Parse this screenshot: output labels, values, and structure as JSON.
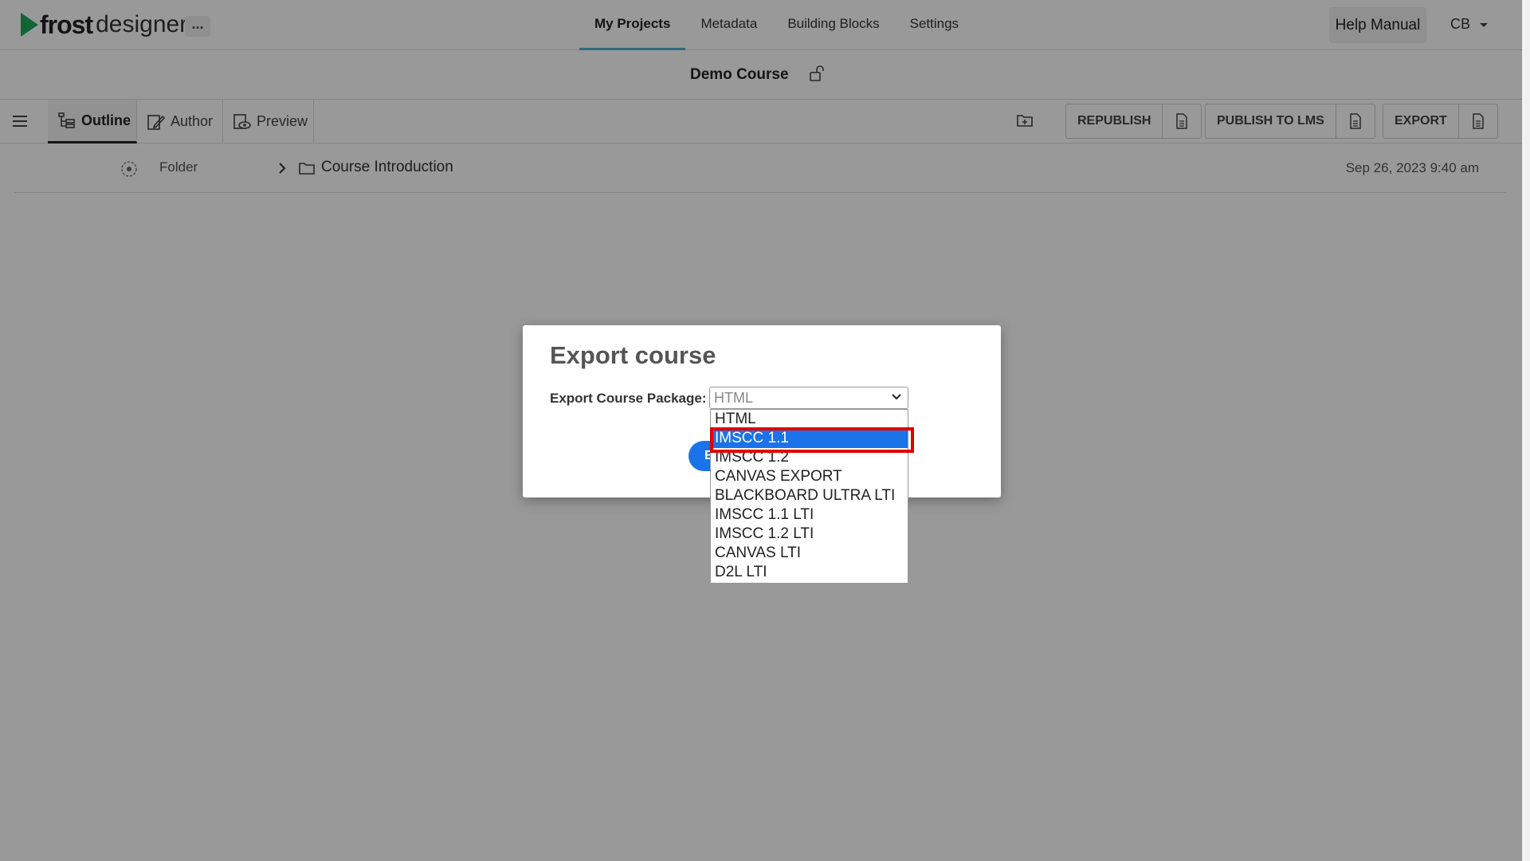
{
  "brand": {
    "name_bold": "frost",
    "name_light": "designer",
    "more_label": "..."
  },
  "nav": {
    "items": [
      "My Projects",
      "Metadata",
      "Building Blocks",
      "Settings"
    ],
    "active": "My Projects",
    "help_label": "Help Manual",
    "user_label": "CB"
  },
  "course": {
    "title": "Demo Course"
  },
  "toolbar": {
    "tabs": [
      "Outline",
      "Author",
      "Preview"
    ],
    "republish": "REPUBLISH",
    "publish_lms": "PUBLISH TO LMS",
    "export": "EXPORT"
  },
  "content": {
    "row": {
      "type": "Folder",
      "name": "Course Introduction",
      "date": "Sep 26, 2023 9:40 am"
    }
  },
  "modal": {
    "title": "Export course",
    "package_label": "Export Course Package:",
    "select_value": "HTML",
    "button_partial": "E",
    "options": [
      "HTML",
      "IMSCC 1.1",
      "IMSCC 1.2",
      "CANVAS EXPORT",
      "BLACKBOARD ULTRA LTI",
      "IMSCC 1.1 LTI",
      "IMSCC 1.2 LTI",
      "CANVAS LTI",
      "D2L LTI"
    ],
    "highlighted_option": "IMSCC 1.1"
  },
  "colors": {
    "accent": "#1a73e8",
    "brand_green": "#1aa95b",
    "highlight_box": "#e00000",
    "nav_underline": "#4fb5d1"
  }
}
